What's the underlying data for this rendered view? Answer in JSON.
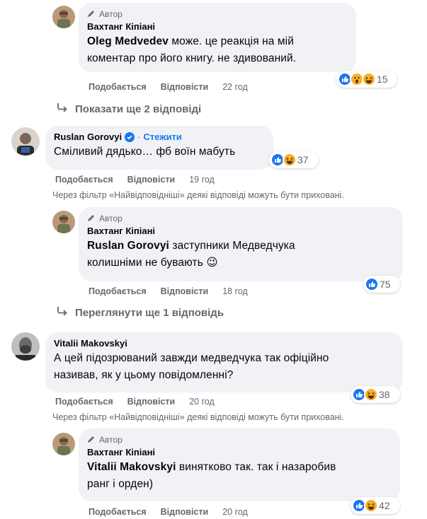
{
  "reply1": {
    "badge": "Автор",
    "author": "Вахтанг Кіпіані",
    "mention": "Oleg Medvedev",
    "line1": " може. це реакція на мій",
    "line2": "коментар про його книгу. не здивований.",
    "like": "Подобається",
    "reply": "Відповісти",
    "time": "22 год",
    "reactions_count": "15"
  },
  "more1": "Показати ще 2 відповіді",
  "comment1": {
    "author": "Ruslan Gorovyi",
    "follow": "Стежити",
    "text": "Сміливий дядько… фб воїн мабуть",
    "like": "Подобається",
    "reply": "Відповісти",
    "time": "19 год",
    "reactions_count": "37"
  },
  "notice1": "Через фільтр «Найвідповідніші» деякі відповіді можуть бути приховані.",
  "reply2": {
    "badge": "Автор",
    "author": "Вахтанг Кіпіані",
    "mention": "Ruslan Gorovyi",
    "line1": " заступники Медведчука",
    "line2": "колишніми не бувають 😉",
    "like": "Подобається",
    "reply": "Відповісти",
    "time": "18 год",
    "reactions_count": "75"
  },
  "more2": "Переглянути ще 1 відповідь",
  "comment2": {
    "author": "Vitalii Makovskyi",
    "line1": "А цей підозрюваний завжди медведчука так офіційно",
    "line2": "називав, як у цьому повідомленні?",
    "like": "Подобається",
    "reply": "Відповісти",
    "time": "20 год",
    "reactions_count": "38"
  },
  "notice2": "Через фільтр «Найвідповідніші» деякі відповіді можуть бути приховані.",
  "reply3": {
    "badge": "Автор",
    "author": "Вахтанг Кіпіані",
    "mention": "Vitalii Makovskyi",
    "line1": " винятково так. так і назаробив",
    "line2": "ранг і орден)",
    "like": "Подобається",
    "reply": "Відповісти",
    "time": "20 год",
    "reactions_count": "42"
  },
  "icons": {
    "author_badge": "pencil-icon",
    "show_more": "reply-arrow-icon",
    "verified": "verified-check-icon",
    "reactions": [
      "like-icon",
      "wow-icon",
      "haha-icon"
    ]
  },
  "colors": {
    "accent": "#1877f2",
    "bubble": "#f0f2f5",
    "secondary_text": "#65676b"
  }
}
